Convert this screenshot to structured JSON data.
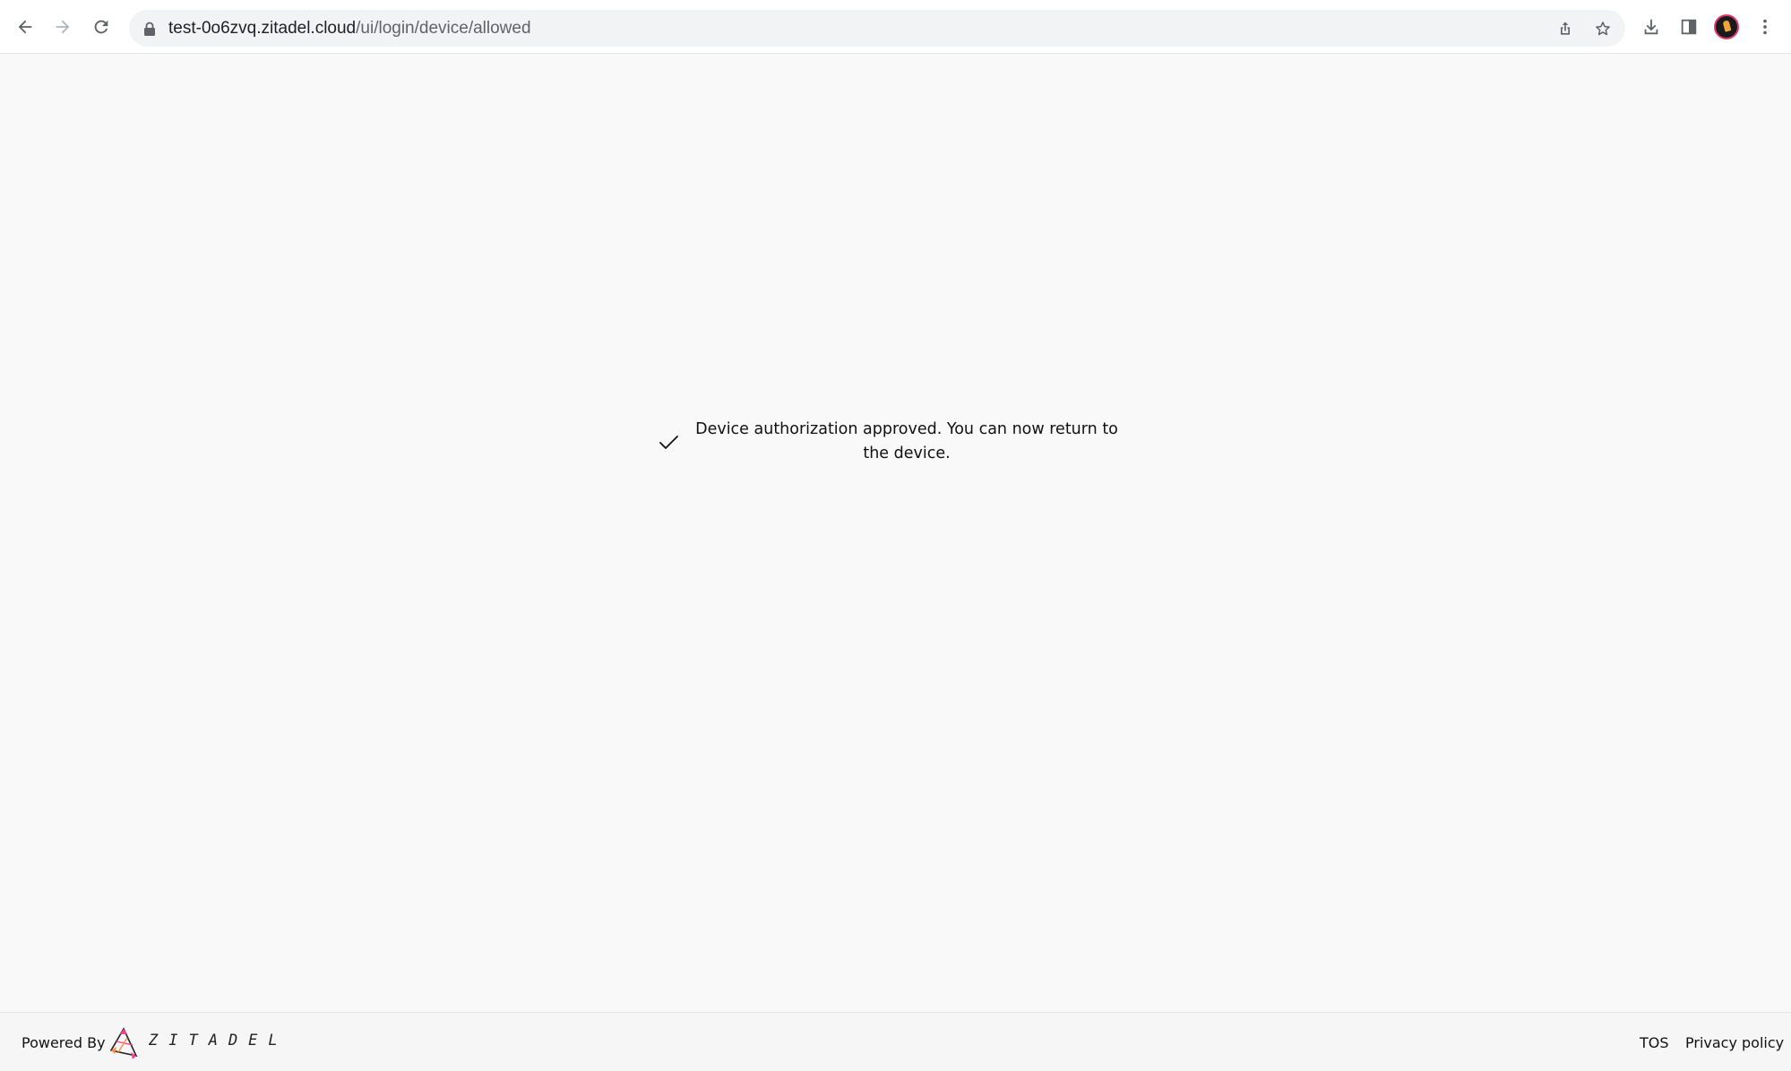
{
  "browser": {
    "url_host": "test-0o6zvq.zitadel.cloud",
    "url_path": "/ui/login/device/allowed",
    "icons": [
      "back-icon",
      "forward-icon",
      "reload-icon",
      "lock-icon",
      "share-icon",
      "star-icon",
      "download-icon",
      "side-panel-icon",
      "profile-avatar",
      "menu-icon"
    ]
  },
  "main": {
    "message": "Device authorization approved. You can now return to the device.",
    "status_icon": "check-icon"
  },
  "footer": {
    "powered_by": "Powered By",
    "brand": "ZITADEL",
    "tos": "TOS",
    "privacy": "Privacy policy"
  },
  "colors": {
    "page_bg": "#f9f9f9",
    "logo_pink": "#ff3d8b",
    "logo_orange": "#ff8f3a"
  }
}
